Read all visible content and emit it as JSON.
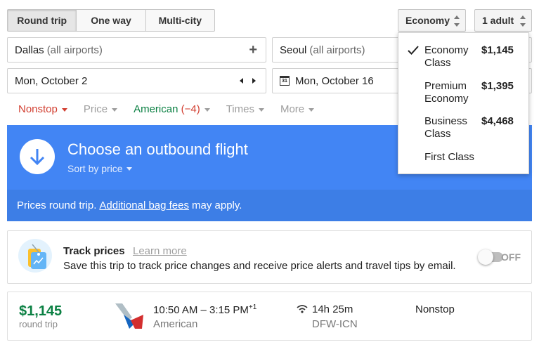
{
  "trip_types": [
    "Round trip",
    "One way",
    "Multi-city"
  ],
  "cabin_select": {
    "selected": "Economy"
  },
  "passengers_select": {
    "selected": "1 adult"
  },
  "origin": {
    "city": "Dallas",
    "qualifier": "(all airports)"
  },
  "destination": {
    "city": "Seoul",
    "qualifier": "(all airports)"
  },
  "depart_date": "Mon, October 2",
  "return_date": "Mon, October 16",
  "calendar_icon_day": "31",
  "filters": {
    "nonstop": "Nonstop",
    "price": "Price",
    "airline": "American",
    "airline_delta": "(−4)",
    "times": "Times",
    "more": "More"
  },
  "banner": {
    "title": "Choose an outbound flight",
    "sort": "Sort by price",
    "note_pre": "Prices round trip.",
    "note_link": "Additional bag fees",
    "note_post": "may apply."
  },
  "track": {
    "title": "Track prices",
    "learn_more": "Learn more",
    "description": "Save this trip to track price changes and receive price alerts and travel tips by email.",
    "toggle_label": "OFF"
  },
  "result": {
    "price": "$1,145",
    "price_note": "round trip",
    "times": "10:50 AM – 3:15 PM",
    "day_offset": "+1",
    "airline": "American",
    "duration": "14h 25m",
    "route": "DFW-ICN",
    "stops": "Nonstop"
  },
  "class_menu": {
    "items": [
      {
        "name": "Economy Class",
        "price": "$1,145",
        "checked": true
      },
      {
        "name": "Premium Economy",
        "price": "$1,395",
        "checked": false
      },
      {
        "name": "Business Class",
        "price": "$4,468",
        "checked": false
      },
      {
        "name": "First Class",
        "price": "",
        "checked": false
      }
    ]
  },
  "colors": {
    "banner_blue": "#4285f4",
    "price_green": "#0b8043",
    "filter_red": "#d23f31"
  }
}
